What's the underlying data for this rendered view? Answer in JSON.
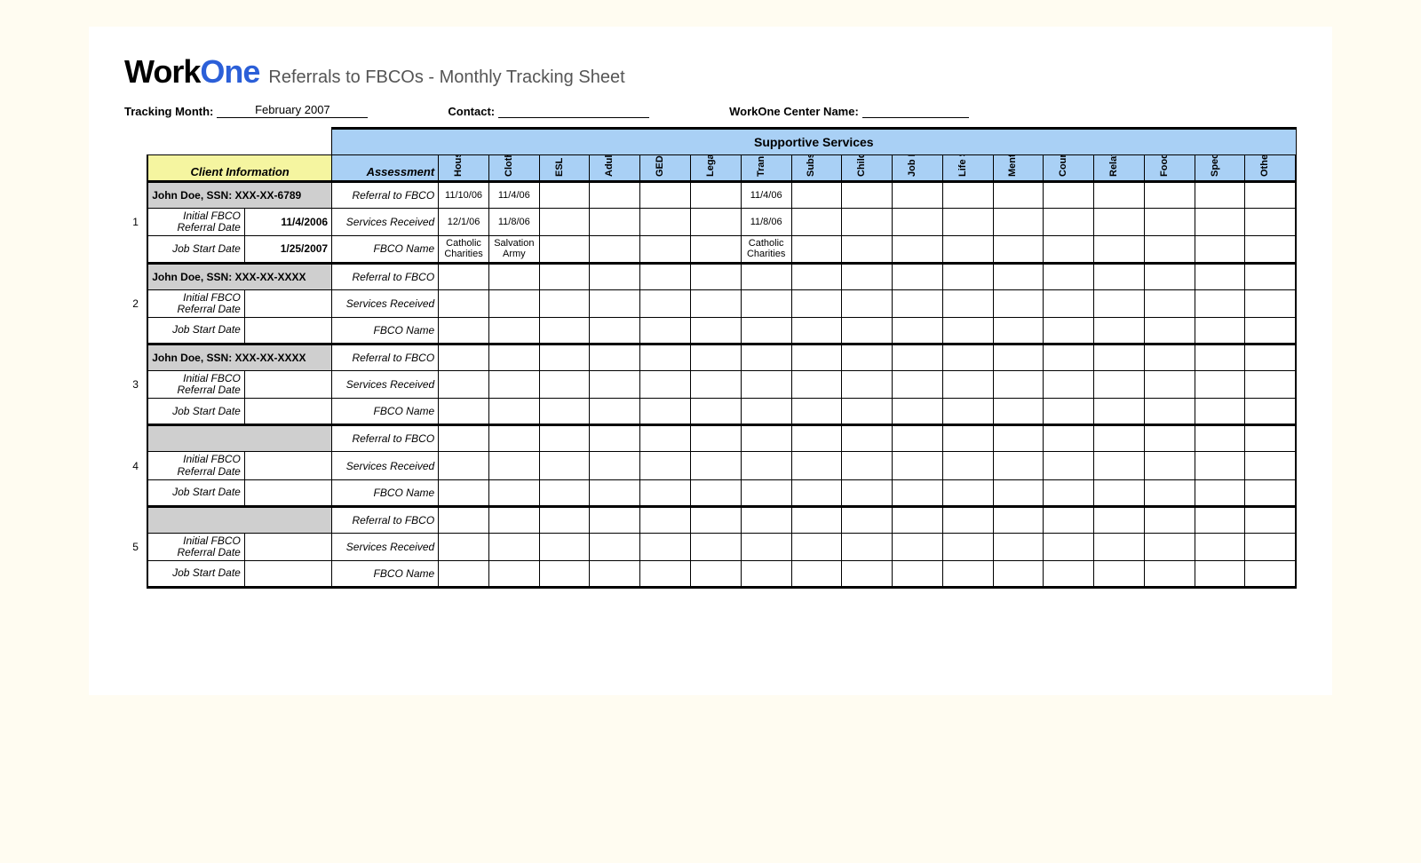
{
  "logo": {
    "part1": "Work",
    "part2": "One"
  },
  "title": "Referrals to FBCOs - Monthly Tracking Sheet",
  "meta": {
    "tracking_month_label": "Tracking Month:",
    "tracking_month_value": "February 2007",
    "contact_label": "Contact:",
    "contact_value": "",
    "center_label": "WorkOne Center Name:",
    "center_value": ""
  },
  "headers": {
    "supportive": "Supportive Services",
    "client_info": "Client Information",
    "assessment": "Assessment",
    "services": [
      "Housing",
      "Clothing",
      "ESL",
      "Adult Basic Education",
      "GED / Pre-GED",
      "Legal Assistance",
      "Transportation",
      "Substance Abuse",
      "Childcare",
      "Job Readiness",
      "Life Skills",
      "Mental Health",
      "Counseling",
      "Relationship Concerns",
      "Food Pantry",
      "Specialized Employment Services",
      "Other:"
    ]
  },
  "row_labels": {
    "initial_referral": "Initial FBCO Referral Date",
    "job_start": "Job Start Date",
    "referral_to_fbco": "Referral to FBCO",
    "services_received": "Services Received",
    "fbco_name": "FBCO Name"
  },
  "blocks": [
    {
      "num": "1",
      "name": "John Doe, SSN: XXX-XX-6789",
      "initial_date": "11/4/2006",
      "job_start": "1/25/2007",
      "rows": {
        "referral": {
          "Housing": "11/10/06",
          "Clothing": "11/4/06",
          "Transportation": "11/4/06"
        },
        "received": {
          "Housing": "12/1/06",
          "Clothing": "11/8/06",
          "Transportation": "11/8/06"
        },
        "fbco": {
          "Housing": "Catholic Charities",
          "Clothing": "Salvation Army",
          "Transportation": "Catholic Charities"
        }
      }
    },
    {
      "num": "2",
      "name": "John Doe, SSN: XXX-XX-XXXX",
      "initial_date": "",
      "job_start": "",
      "rows": {
        "referral": {},
        "received": {},
        "fbco": {}
      }
    },
    {
      "num": "3",
      "name": "John Doe, SSN: XXX-XX-XXXX",
      "initial_date": "",
      "job_start": "",
      "rows": {
        "referral": {},
        "received": {},
        "fbco": {}
      }
    },
    {
      "num": "4",
      "name": "",
      "initial_date": "",
      "job_start": "",
      "rows": {
        "referral": {},
        "received": {},
        "fbco": {}
      }
    },
    {
      "num": "5",
      "name": "",
      "initial_date": "",
      "job_start": "",
      "rows": {
        "referral": {},
        "received": {},
        "fbco": {}
      }
    }
  ]
}
